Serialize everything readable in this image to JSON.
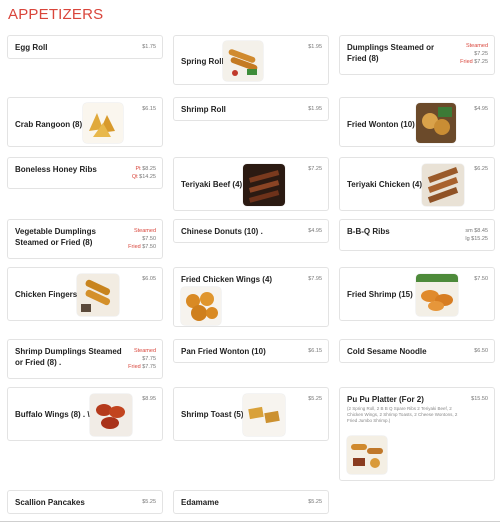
{
  "section": {
    "title": "APPETIZERS"
  },
  "items": [
    {
      "name": "Egg Roll",
      "price": "$1.75"
    },
    {
      "name": "Spring Roll",
      "price": "$1.95",
      "image": "spring-roll-photo"
    },
    {
      "name": "Dumplings Steamed or Fried (8)",
      "prices": [
        {
          "label": "Steamed",
          "value": "$7.25"
        },
        {
          "label": "Fried",
          "value": "$7.25"
        }
      ]
    },
    {
      "name": "Crab Rangoon (8)",
      "price": "$6.15",
      "image": "crab-rangoon-photo"
    },
    {
      "name": "Shrimp Roll",
      "price": "$1.95"
    },
    {
      "name": "Fried Wonton (10)",
      "price": "$4.95",
      "image": "fried-wonton-photo"
    },
    {
      "name": "Boneless Honey Ribs",
      "prices": [
        {
          "label": "Pt",
          "value": "$8.25"
        },
        {
          "label": "Qt",
          "value": "$14.25"
        }
      ]
    },
    {
      "name": "Teriyaki Beef (4)",
      "price": "$7.25",
      "image": "teriyaki-beef-photo"
    },
    {
      "name": "Teriyaki Chicken (4)",
      "price": "$6.25",
      "image": "teriyaki-chicken-photo"
    },
    {
      "name": "Vegetable Dumplings Steamed or Fried (8)",
      "prices": [
        {
          "label": "Steamed",
          "value": "$7.50"
        },
        {
          "label": "Fried",
          "value": "$7.50"
        }
      ]
    },
    {
      "name": "Chinese Donuts (10) .",
      "price": "$4.95"
    },
    {
      "name": "B-B-Q Ribs",
      "prices": [
        {
          "label": "sm",
          "value": "$8.45"
        },
        {
          "label": "lg",
          "value": "$15.25"
        }
      ]
    },
    {
      "name": "Chicken Fingers",
      "price": "$6.05",
      "image": "chicken-fingers-photo"
    },
    {
      "name": "Fried Chicken Wings (4)",
      "price": "$7.95",
      "image": "chicken-wings-photo"
    },
    {
      "name": "Fried Shrimp (15)",
      "price": "$7.50",
      "image": "fried-shrimp-photo"
    },
    {
      "name": "Shrimp Dumplings Steamed or Fried (8) .",
      "prices": [
        {
          "label": "Steamed",
          "value": "$7.75"
        },
        {
          "label": "Fried",
          "value": "$7.75"
        }
      ]
    },
    {
      "name": "Pan Fried Wonton (10)",
      "price": "$6.15"
    },
    {
      "name": "Cold Sesame Noodle",
      "price": "$6.50"
    },
    {
      "name": "Buffalo Wings (8) . \\",
      "price": "$8.95",
      "image": "buffalo-wings-photo"
    },
    {
      "name": "Shrimp Toast (5)",
      "price": "$5.25",
      "image": "shrimp-toast-photo"
    },
    {
      "name": "Pu Pu Platter (For 2)",
      "price": "$15.50",
      "description": "(2 Spring Roll, 2 B B Q Spare Ribs 2 Teriyaki Beef, 2 Chicken Wings, 2 Shrimp Toasts, 2 Cheese Wontons, 2 Fried Jumbo Shrimp.)",
      "image": "pu-pu-platter-photo"
    },
    {
      "name": "Scallion Pancakes",
      "price": "$5.25"
    },
    {
      "name": "Edamame",
      "price": "$5.25"
    }
  ],
  "colors": {
    "accent": "#d9453b",
    "card_border": "#e3e3e3",
    "price_gray": "#777777"
  }
}
